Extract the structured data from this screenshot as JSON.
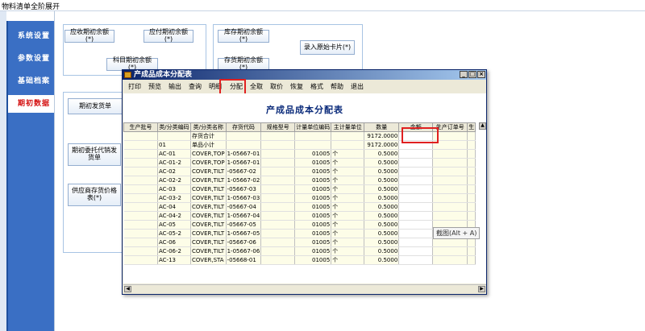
{
  "app": {
    "title": "物料清单全阶展开"
  },
  "nav": {
    "items": [
      {
        "label": "系统设置"
      },
      {
        "label": "参数设置"
      },
      {
        "label": "基础档案"
      },
      {
        "label": "期初数据"
      }
    ]
  },
  "buttons": {
    "ar_opening": "应收期初余额(*)",
    "ap_opening": "应付期初余额(*)",
    "account_opening": "科目期初余额(*)",
    "inventory_opening": "库存期初余额(*)",
    "stock_opening": "存货期初余额(*)",
    "enter_asset_cards": "录入原始卡片(*)",
    "opening_delivery": "期初发货单",
    "consignment_delivery": "期初委托代销发货单",
    "supplier_price": "供应商存货价格表(*)"
  },
  "dialog": {
    "title": "产成品成本分配表",
    "menu": [
      "打印",
      "预览",
      "输出",
      "查询",
      "明细",
      "分配",
      "全取",
      "取价",
      "恢复",
      "格式",
      "帮助",
      "退出"
    ],
    "report_title": "产成品成本分配表",
    "columns": [
      "生产批号",
      "类/分类编码",
      "类/分类名称",
      "存货代码",
      "规格型号",
      "计量单位编码",
      "主计量单位",
      "数量",
      "金额",
      "生产订单号",
      "生"
    ],
    "rows": [
      [
        "",
        "",
        "存货合计",
        "",
        "",
        "",
        "",
        "9172.0000",
        "",
        "",
        ""
      ],
      [
        "",
        "01",
        "单品小计",
        "",
        "",
        "",
        "",
        "9172.0000",
        "",
        "",
        ""
      ],
      [
        "",
        "AC-01",
        "COVER,TOP",
        "1-05667-01",
        "",
        "01005",
        "个",
        "0.5000",
        "",
        "",
        ""
      ],
      [
        "",
        "AC-01-2",
        "COVER,TOP",
        "1-05667-01",
        "",
        "01005",
        "个",
        "0.5000",
        "",
        "",
        ""
      ],
      [
        "",
        "AC-02",
        "COVER,TILT",
        "-05667-02",
        "",
        "01005",
        "个",
        "0.5000",
        "",
        "",
        ""
      ],
      [
        "",
        "AC-02-2",
        "COVER,TILT",
        "1-05667-02",
        "",
        "01005",
        "个",
        "0.5000",
        "",
        "",
        ""
      ],
      [
        "",
        "AC-03",
        "COVER,TILT",
        "-05667-03",
        "",
        "01005",
        "个",
        "0.5000",
        "",
        "",
        ""
      ],
      [
        "",
        "AC-03-2",
        "COVER,TILT",
        "1-05667-03",
        "",
        "01005",
        "个",
        "0.5000",
        "",
        "",
        ""
      ],
      [
        "",
        "AC-04",
        "COVER,TILT",
        "-05667-04",
        "",
        "01005",
        "个",
        "0.5000",
        "",
        "",
        ""
      ],
      [
        "",
        "AC-04-2",
        "COVER,TILT",
        "1-05667-04",
        "",
        "01005",
        "个",
        "0.5000",
        "",
        "",
        ""
      ],
      [
        "",
        "AC-05",
        "COVER,TILT",
        "-05667-05",
        "",
        "01005",
        "个",
        "0.5000",
        "",
        "",
        ""
      ],
      [
        "",
        "AC-05-2",
        "COVER,TILT",
        "1-05667-05",
        "",
        "01005",
        "个",
        "0.5000",
        "",
        "",
        ""
      ],
      [
        "",
        "AC-06",
        "COVER,TILT",
        "-05667-06",
        "",
        "01005",
        "个",
        "0.5000",
        "",
        "",
        ""
      ],
      [
        "",
        "AC-06-2",
        "COVER,TILT",
        "1-05667-06",
        "",
        "01005",
        "个",
        "0.5000",
        "",
        "",
        ""
      ],
      [
        "",
        "AC-13",
        "COVER,STA",
        "-05668-01",
        "",
        "01005",
        "个",
        "0.5000",
        "",
        "",
        ""
      ]
    ]
  },
  "tooltip": {
    "text": "截图(Alt + A)"
  }
}
